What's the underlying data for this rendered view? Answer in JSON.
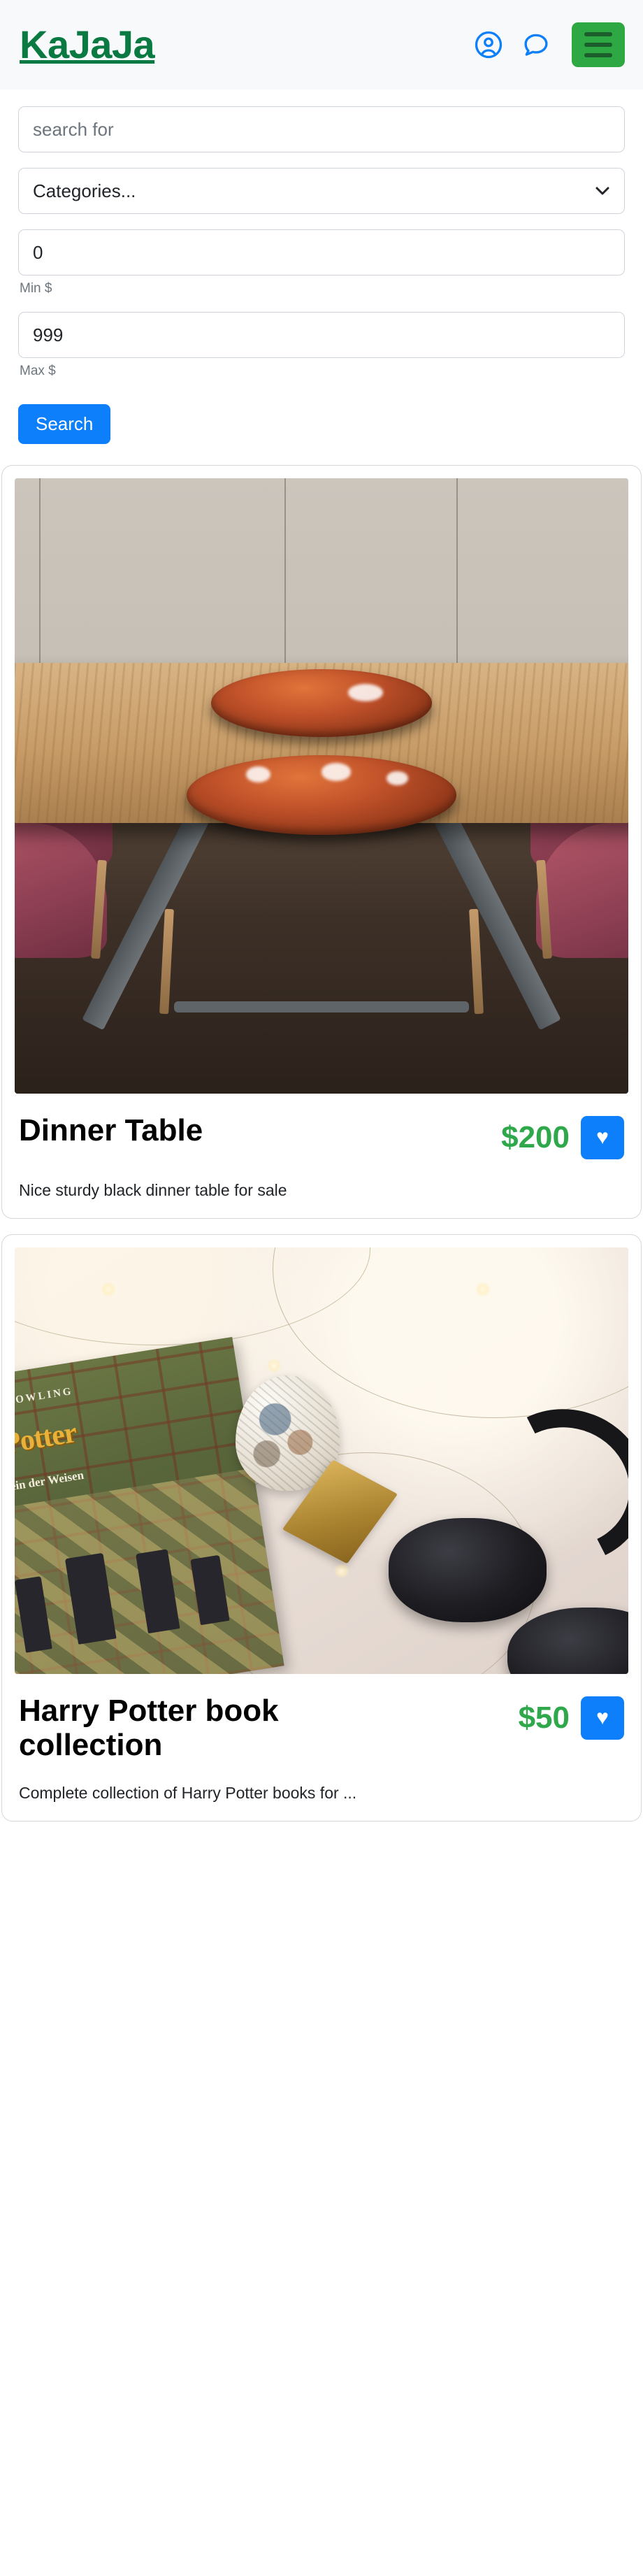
{
  "header": {
    "brand": "KaJaJa",
    "brand_color": "#0a7a42",
    "account_icon": "user-circle-icon",
    "messages_icon": "chat-bubble-icon",
    "menu_icon": "hamburger-menu-icon",
    "menu_button_color": "#2ea843",
    "icon_color": "#0d7ffa",
    "background": "#f8f9fa"
  },
  "search": {
    "query_value": "",
    "query_placeholder": "search for",
    "category_selected": "Categories...",
    "category_options": [
      "Categories..."
    ],
    "min_price_value": "0",
    "min_price_label": "Min $",
    "max_price_value": "999",
    "max_price_label": "Max $",
    "submit_label": "Search",
    "submit_color": "#0d7ffa",
    "caret_icon": "chevron-down-icon"
  },
  "listings": [
    {
      "title": "Dinner Table",
      "price": "$200",
      "description": "Nice sturdy black dinner table for sale",
      "image_alt": "wooden dinner table with two red bowls and pink velvet chairs",
      "favorite_icon": "heart-icon",
      "price_color": "#2ea84a",
      "favorite_color": "#0d7ffa"
    },
    {
      "title": "Harry Potter book collection",
      "price": "$50",
      "description": "Complete collection of Harry Potter books for ...",
      "image_alt": "Harry Potter book with fairy lights, decorated egg and black headphones",
      "favorite_icon": "heart-icon",
      "price_color": "#2ea84a",
      "favorite_color": "#0d7ffa",
      "book_cover": {
        "author": "NE K. ROWLING",
        "title": "rry Potter",
        "subtitle": "d der Stein der Weisen"
      }
    }
  ]
}
